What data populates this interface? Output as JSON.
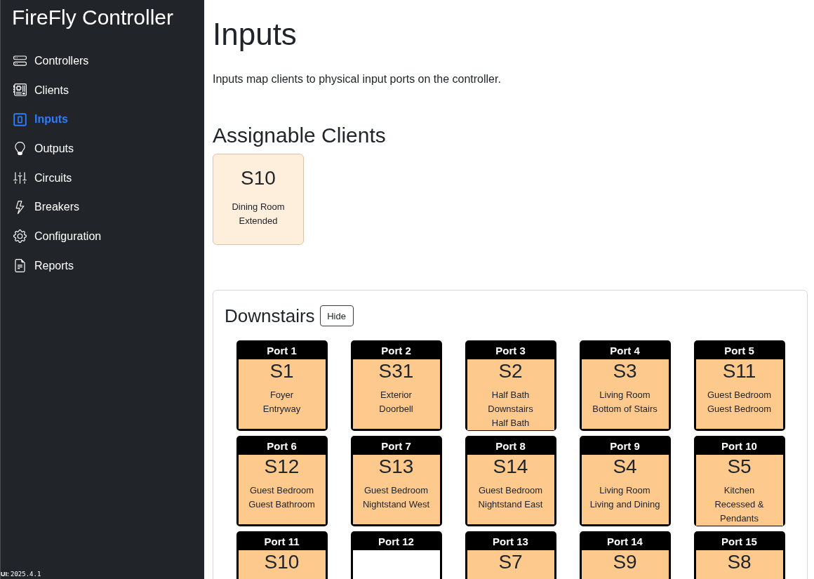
{
  "sidebar": {
    "title": "FireFly Controller",
    "items": [
      {
        "label": "Controllers",
        "kind": "controllers",
        "selected": false
      },
      {
        "label": "Clients",
        "kind": "clients",
        "selected": false
      },
      {
        "label": "Inputs",
        "kind": "inputs",
        "selected": true
      },
      {
        "label": "Outputs",
        "kind": "outputs",
        "selected": false
      },
      {
        "label": "Circuits",
        "kind": "circuits",
        "selected": false
      },
      {
        "label": "Breakers",
        "kind": "breakers",
        "selected": false
      },
      {
        "label": "Configuration",
        "kind": "configuration",
        "selected": false
      },
      {
        "label": "Reports",
        "kind": "reports",
        "selected": false
      }
    ],
    "version": {
      "label": "UI:",
      "value": "2025.4.1"
    }
  },
  "page": {
    "title": "Inputs",
    "description": "Inputs map clients to physical input ports on the controller."
  },
  "assignable": {
    "title": "Assignable Clients",
    "clients": [
      {
        "name": "S10",
        "lines": [
          "Dining Room",
          "Extended"
        ]
      }
    ]
  },
  "groups": [
    {
      "title": "Downstairs",
      "button": "Hide",
      "ports": [
        {
          "label": "Port 1",
          "assigned": true,
          "client": "S1",
          "lines": [
            "Foyer",
            "Entryway"
          ]
        },
        {
          "label": "Port 2",
          "assigned": true,
          "client": "S31",
          "lines": [
            "Exterior",
            "Doorbell"
          ]
        },
        {
          "label": "Port 3",
          "assigned": true,
          "client": "S2",
          "lines": [
            "Half Bath",
            "Downstairs",
            "Half Bath"
          ]
        },
        {
          "label": "Port 4",
          "assigned": true,
          "client": "S3",
          "lines": [
            "Living Room",
            "Bottom of Stairs"
          ]
        },
        {
          "label": "Port 5",
          "assigned": true,
          "client": "S11",
          "lines": [
            "Guest Bedroom",
            "Guest Bedroom"
          ]
        },
        {
          "label": "Port 6",
          "assigned": true,
          "client": "S12",
          "lines": [
            "Guest Bedroom",
            "Guest Bathroom"
          ]
        },
        {
          "label": "Port 7",
          "assigned": true,
          "client": "S13",
          "lines": [
            "Guest Bedroom",
            "Nightstand West"
          ]
        },
        {
          "label": "Port 8",
          "assigned": true,
          "client": "S14",
          "lines": [
            "Guest Bedroom",
            "Nightstand East"
          ]
        },
        {
          "label": "Port 9",
          "assigned": true,
          "client": "S4",
          "lines": [
            "Living Room",
            "Living and Dining"
          ]
        },
        {
          "label": "Port 10",
          "assigned": true,
          "client": "S5",
          "lines": [
            "Kitchen",
            "Recessed & Pendants"
          ]
        },
        {
          "label": "Port 11",
          "assigned": true,
          "client": "S10"
        },
        {
          "label": "Port 12",
          "assigned": false
        },
        {
          "label": "Port 13",
          "assigned": true,
          "client": "S7"
        },
        {
          "label": "Port 14",
          "assigned": true,
          "client": "S9"
        },
        {
          "label": "Port 15",
          "assigned": true,
          "client": "S8"
        }
      ]
    }
  ]
}
